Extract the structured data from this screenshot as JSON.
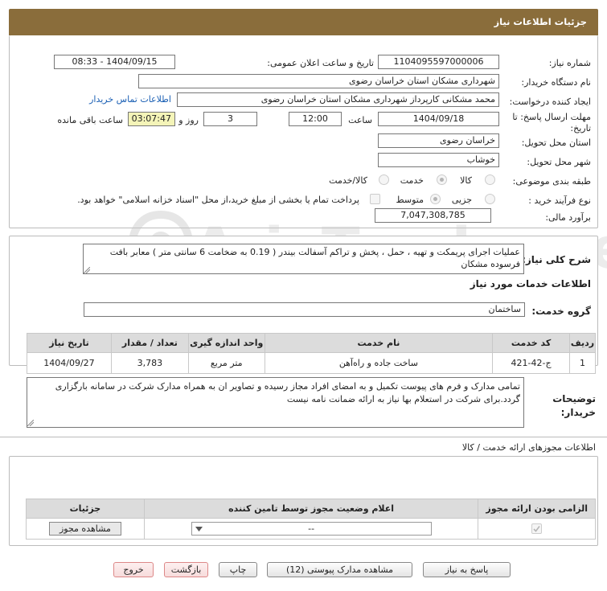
{
  "header": {
    "title": "جزئیات اطلاعات نیاز"
  },
  "form": {
    "need_number_label": "شماره نیاز:",
    "need_number": "1104095597000006",
    "announce_label": "تاریخ و ساعت اعلان عمومی:",
    "announce_value": "1404/09/15 - 08:33",
    "buyer_org_label": "نام دستگاه خریدار:",
    "buyer_org": "شهرداری مشکان استان خراسان رضوی",
    "requester_label": "ایجاد کننده درخواست:",
    "requester": "محمد مشکانی کارپرداز شهرداری مشکان استان خراسان رضوی",
    "contact_link": "اطلاعات تماس خریدار",
    "deadline_label": "مهلت ارسال پاسخ: تا تاریخ:",
    "deadline_date": "1404/09/18",
    "time_label": "ساعت",
    "deadline_time": "12:00",
    "days_value": "3",
    "days_label": "روز و",
    "remaining_time": "03:07:47",
    "remaining_label": "ساعت باقی مانده",
    "province_label": "استان محل تحویل:",
    "province": "خراسان رضوی",
    "city_label": "شهر محل تحویل:",
    "city": "خوشاب",
    "category_label": "طبقه بندی موضوعی:",
    "category_options": [
      "کالا",
      "خدمت",
      "کالا/خدمت"
    ],
    "process_label": "نوع فرآیند خرید :",
    "process_options": [
      "جزیی",
      "متوسط"
    ],
    "payment_note": "پرداخت تمام یا بخشی از مبلغ خرید،از محل \"اسناد خزانه اسلامی\" خواهد بود.",
    "budget_label": "برآورد مالی:",
    "budget": "7,047,308,785"
  },
  "summary": {
    "label": "شرح کلی نیاز:",
    "text": "عملیات اجرای پریمکت و تهیه ، حمل ، پخش و تراکم آسفالت بیندر ( 0.19 به ضخامت 6 سانتی متر ) معابر بافت فرسوده مشکان"
  },
  "services": {
    "section_title": "اطلاعات خدمات مورد نیاز",
    "group_label": "گروه خدمت:",
    "group_value": "ساختمان",
    "columns": [
      "ردیف",
      "کد خدمت",
      "نام خدمت",
      "واحد اندازه گیری",
      "تعداد / مقدار",
      "تاریخ نیاز"
    ],
    "rows": [
      {
        "idx": "1",
        "code": "ج-42-421",
        "name": "ساخت جاده و راه‌آهن",
        "unit": "متر مربع",
        "qty": "3,783",
        "date": "1404/09/27"
      }
    ]
  },
  "buyer_notes": {
    "label": "توضیحات خریدار:",
    "text": "تمامی مدارک و فرم های پیوست تکمیل و به امضای افراد مجاز رسیده و تصاویر ان به همراه مدارک شرکت در سامانه بارگزاری گردد.برای شرکت در استعلام بها نیاز به ارائه ضمانت نامه نیست"
  },
  "permits": {
    "title": "اطلاعات مجوزهای ارائه خدمت / کالا",
    "columns": [
      "الزامی بودن ارائه مجوز",
      "اعلام وضعیت مجوز توسط تامین کننده",
      "جزئیات"
    ],
    "select_value": "--",
    "view_button": "مشاهده مجوز"
  },
  "buttons": {
    "reply": "پاسخ به نیاز",
    "attachments": "مشاهده مدارک پیوستی (12)",
    "print": "چاپ",
    "back": "بازگشت",
    "exit": "خروج"
  }
}
